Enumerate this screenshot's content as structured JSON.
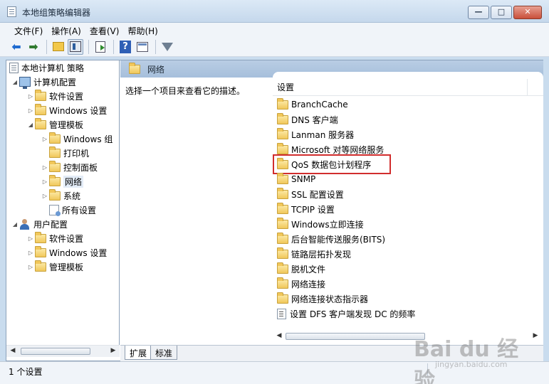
{
  "window": {
    "title": "本地组策略编辑器",
    "controls": {
      "minimize": "—",
      "maximize": "□",
      "close": "✕"
    }
  },
  "menu": [
    "文件(F)",
    "操作(A)",
    "查看(V)",
    "帮助(H)"
  ],
  "toolbar": {
    "icons": [
      "back-arrow-icon",
      "forward-arrow-icon",
      "up-folder-icon",
      "show-hide-tree-icon",
      "export-list-icon",
      "help-icon",
      "properties-icon",
      "filter-icon"
    ]
  },
  "tree": {
    "root": "本地计算机 策略",
    "computer_config": "计算机配置",
    "cc_software": "软件设置",
    "cc_windows": "Windows 设置",
    "cc_admin": "管理模板",
    "cc_admin_windows": "Windows 组",
    "cc_admin_printers": "打印机",
    "cc_admin_control": "控制面板",
    "cc_admin_network": "网络",
    "cc_admin_system": "系统",
    "cc_admin_all": "所有设置",
    "user_config": "用户配置",
    "uc_software": "软件设置",
    "uc_windows": "Windows 设置",
    "uc_admin": "管理模板"
  },
  "right_pane": {
    "header": "网络",
    "description": "选择一个项目来查看它的描述。",
    "column_header": "设置",
    "items": [
      "BranchCache",
      "DNS 客户端",
      "Lanman 服务器",
      "Microsoft 对等网络服务",
      "QoS 数据包计划程序",
      "SNMP",
      "SSL 配置设置",
      "TCPIP 设置",
      "Windows立即连接",
      "后台智能传送服务(BITS)",
      "链路层拓扑发现",
      "脱机文件",
      "网络连接",
      "网络连接状态指示器"
    ],
    "setting_item": "设置 DFS 客户端发现 DC 的频率",
    "highlighted_item": "QoS 数据包计划程序"
  },
  "tabs": [
    "扩展",
    "标准"
  ],
  "status": "1 个设置",
  "watermark": {
    "logo": "Bai du 经验",
    "sub": "jingyan.baidu.com"
  },
  "colors": {
    "highlight": "#d12d2d",
    "header_bg": "#b9cde4",
    "folder": "#f1c75a"
  }
}
